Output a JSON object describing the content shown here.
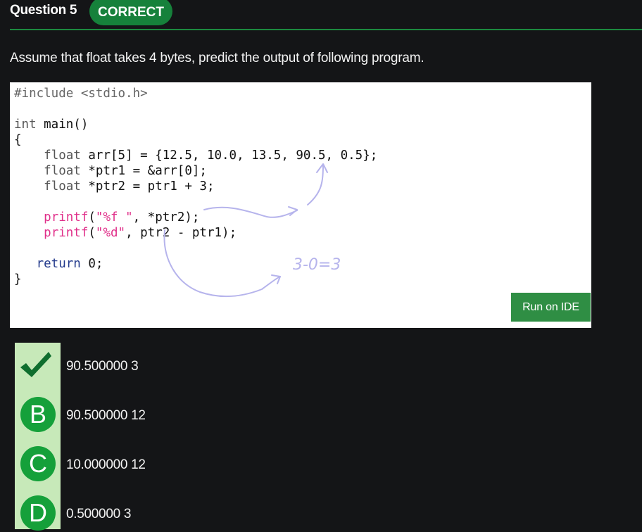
{
  "question": {
    "label": "Question 5",
    "status": "CORRECT",
    "prompt": "Assume that float takes 4 bytes, predict the output of following program."
  },
  "code": {
    "include": "#include <stdio.h>",
    "main_type": "int",
    "main_sig": " main()",
    "open_brace": "{",
    "line1_type": "float",
    "line1_rest": " arr[5] = {12.5, 10.0, 13.5, 90.5, 0.5};",
    "line2_type": "float",
    "line2_rest": " *ptr1 = &arr[0];",
    "line3_type": "float",
    "line3_rest": " *ptr2 = ptr1 + 3;",
    "printf1_fn": "printf",
    "printf1_open": "(",
    "printf1_str": "\"%f \"",
    "printf1_rest": ", *ptr2);",
    "printf2_fn": "printf",
    "printf2_open": "(",
    "printf2_str": "\"%d\"",
    "printf2_rest": ", ptr2 - ptr1);",
    "return_kw": "return",
    "return_rest": " 0;",
    "close_brace": "}"
  },
  "annotation": {
    "handwritten_note": "3-0=3",
    "ink_color": "#b6b4ec"
  },
  "run_button": {
    "label": "Run on IDE"
  },
  "options": [
    {
      "marker": "check-icon",
      "text": "90.500000 3",
      "correct": true
    },
    {
      "marker": "B",
      "text": "90.500000 12"
    },
    {
      "marker": "C",
      "text": "10.000000 12"
    },
    {
      "marker": "D",
      "text": "0.500000 3"
    }
  ],
  "colors": {
    "background": "#141517",
    "accent_green": "#16813b",
    "run_button": "#2f8e44",
    "option_strip": "#c7e9b9",
    "marker_green": "#15a03a",
    "keyword_pink": "#e0308a",
    "return_blue": "#233a8c"
  }
}
